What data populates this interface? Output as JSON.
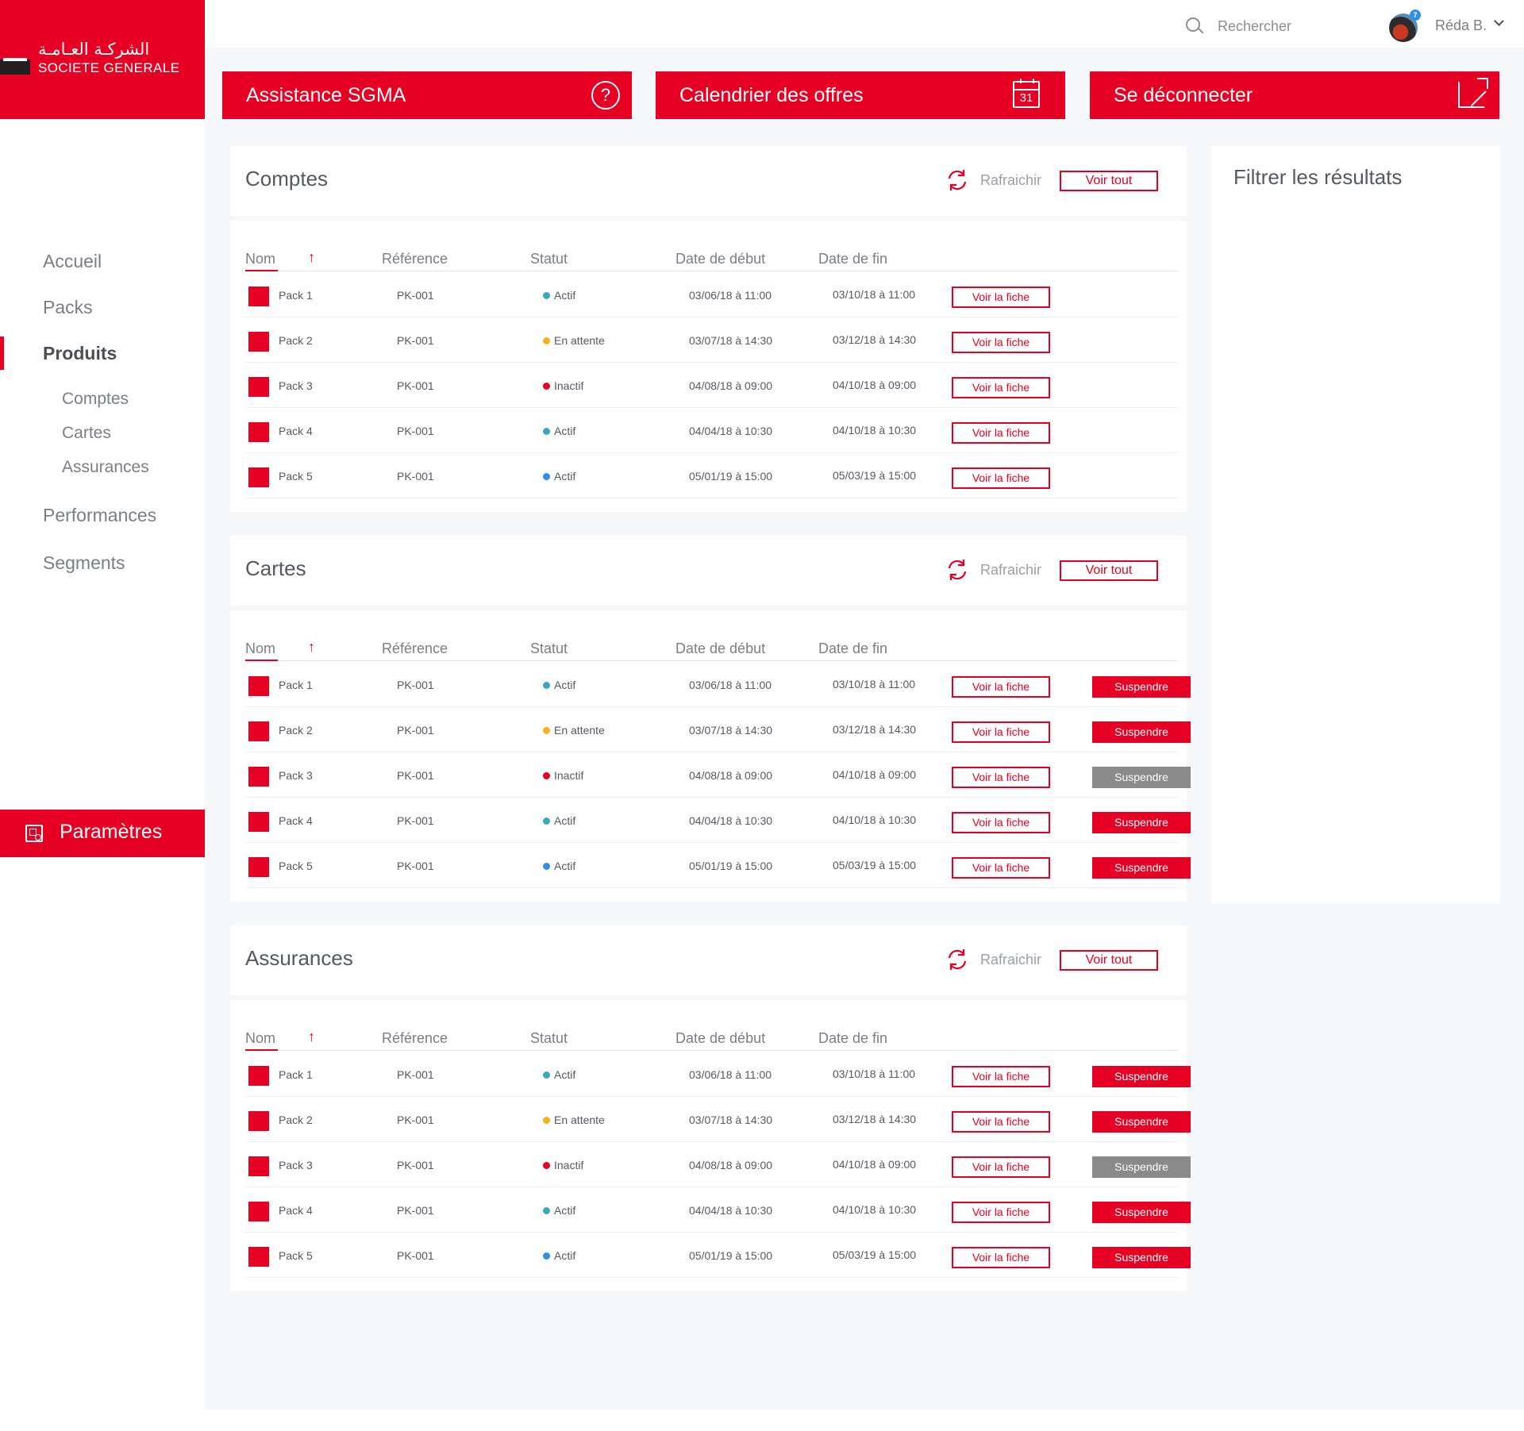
{
  "brand": {
    "arabic": "الشركـة العـامـة",
    "latin": "SOCIETE GENERALE",
    "color": "#e60023"
  },
  "topbar": {
    "search_placeholder": "Rechercher",
    "user_name": "Réda B.",
    "notification_count": "7"
  },
  "actions": [
    {
      "label": "Assistance SGMA",
      "icon": "help-icon"
    },
    {
      "label": "Calendrier des offres",
      "icon": "calendar-icon",
      "icon_text": "31"
    },
    {
      "label": "Se déconnecter",
      "icon": "external-link-icon"
    }
  ],
  "sidebar": {
    "items": [
      {
        "label": "Accueil",
        "active": false
      },
      {
        "label": "Packs",
        "active": false
      },
      {
        "label": "Produits",
        "active": true
      },
      {
        "label": "Performances",
        "active": false
      },
      {
        "label": "Segments",
        "active": false
      }
    ],
    "subitems": [
      {
        "label": "Comptes"
      },
      {
        "label": "Cartes"
      },
      {
        "label": "Assurances"
      }
    ],
    "settings_label": "Paramètres"
  },
  "filter": {
    "title": "Filtrer les résultats"
  },
  "table": {
    "refresh_label": "Rafraichir",
    "view_all_label": "Voir tout",
    "view_card_label": "Voir la fiche",
    "suspend_label": "Suspendre",
    "columns": [
      "Nom",
      "Référence",
      "Statut",
      "Date de début",
      "Date de fin"
    ],
    "status_colors": {
      "Actif": "#3aa7c6",
      "En attente": "#f6b21a",
      "Inactif": "#e60023",
      "Actif bleu": "#2f8fe6"
    }
  },
  "sections": [
    {
      "title": "Comptes",
      "show_suspend": false,
      "rows": [
        {
          "name": "Pack 1",
          "ref": "PK-001",
          "status": "Actif",
          "status_color": "#3aa7c6",
          "start": "03/06/18 à 11:00",
          "end": "03/10/18 à 11:00",
          "suspend_disabled": false
        },
        {
          "name": "Pack 2",
          "ref": "PK-001",
          "status": "En attente",
          "status_color": "#f6b21a",
          "start": "03/07/18 à 14:30",
          "end": "03/12/18 à 14:30",
          "suspend_disabled": false
        },
        {
          "name": "Pack 3",
          "ref": "PK-001",
          "status": "Inactif",
          "status_color": "#e60023",
          "start": "04/08/18 à 09:00",
          "end": "04/10/18 à 09:00",
          "suspend_disabled": false
        },
        {
          "name": "Pack 4",
          "ref": "PK-001",
          "status": "Actif",
          "status_color": "#3aa7c6",
          "start": "04/04/18 à 10:30",
          "end": "04/10/18 à 10:30",
          "suspend_disabled": false
        },
        {
          "name": "Pack 5",
          "ref": "PK-001",
          "status": "Actif",
          "status_color": "#2f8fe6",
          "start": "05/01/19 à 15:00",
          "end": "05/03/19 à 15:00",
          "suspend_disabled": false
        }
      ]
    },
    {
      "title": "Cartes",
      "show_suspend": true,
      "rows": [
        {
          "name": "Pack 1",
          "ref": "PK-001",
          "status": "Actif",
          "status_color": "#3aa7c6",
          "start": "03/06/18 à 11:00",
          "end": "03/10/18 à 11:00",
          "suspend_disabled": false
        },
        {
          "name": "Pack 2",
          "ref": "PK-001",
          "status": "En attente",
          "status_color": "#f6b21a",
          "start": "03/07/18 à 14:30",
          "end": "03/12/18 à 14:30",
          "suspend_disabled": false
        },
        {
          "name": "Pack 3",
          "ref": "PK-001",
          "status": "Inactif",
          "status_color": "#e60023",
          "start": "04/08/18 à 09:00",
          "end": "04/10/18 à 09:00",
          "suspend_disabled": true
        },
        {
          "name": "Pack 4",
          "ref": "PK-001",
          "status": "Actif",
          "status_color": "#3aa7c6",
          "start": "04/04/18 à 10:30",
          "end": "04/10/18 à 10:30",
          "suspend_disabled": false
        },
        {
          "name": "Pack 5",
          "ref": "PK-001",
          "status": "Actif",
          "status_color": "#2f8fe6",
          "start": "05/01/19 à 15:00",
          "end": "05/03/19 à 15:00",
          "suspend_disabled": false
        }
      ]
    },
    {
      "title": "Assurances",
      "show_suspend": true,
      "rows": [
        {
          "name": "Pack 1",
          "ref": "PK-001",
          "status": "Actif",
          "status_color": "#3aa7c6",
          "start": "03/06/18 à 11:00",
          "end": "03/10/18 à 11:00",
          "suspend_disabled": false
        },
        {
          "name": "Pack 2",
          "ref": "PK-001",
          "status": "En attente",
          "status_color": "#f6b21a",
          "start": "03/07/18 à 14:30",
          "end": "03/12/18 à 14:30",
          "suspend_disabled": false
        },
        {
          "name": "Pack 3",
          "ref": "PK-001",
          "status": "Inactif",
          "status_color": "#e60023",
          "start": "04/08/18 à 09:00",
          "end": "04/10/18 à 09:00",
          "suspend_disabled": true
        },
        {
          "name": "Pack 4",
          "ref": "PK-001",
          "status": "Actif",
          "status_color": "#3aa7c6",
          "start": "04/04/18 à 10:30",
          "end": "04/10/18 à 10:30",
          "suspend_disabled": false
        },
        {
          "name": "Pack 5",
          "ref": "PK-001",
          "status": "Actif",
          "status_color": "#2f8fe6",
          "start": "05/01/19 à 15:00",
          "end": "05/03/19 à 15:00",
          "suspend_disabled": false
        }
      ]
    }
  ]
}
